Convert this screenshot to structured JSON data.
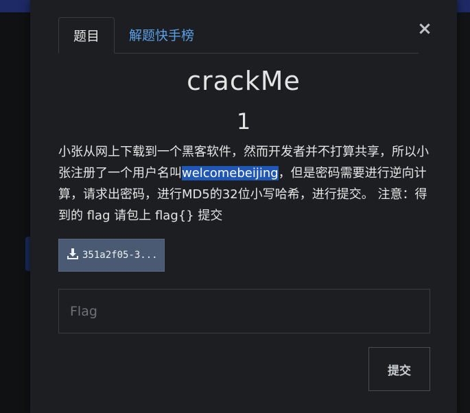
{
  "tabs": [
    {
      "label": "题目"
    },
    {
      "label": "解题快手榜"
    }
  ],
  "close_label": "×",
  "challenge": {
    "name": "crackMe",
    "points": "1",
    "description_before": "小张从网上下载到一个黑客软件，然而开发者并不打算共享，所以小张注册了一个用户名叫",
    "description_highlight": "welcomebeijing",
    "description_after": "，但是密码需要进行逆向计算，请求出密码，进行MD5的32位小写哈希，进行提交。 注意：得到的 flag 请包上 flag{} 提交"
  },
  "attachment": {
    "label": "351a2f05-3...",
    "icon": "download-icon"
  },
  "flag_input": {
    "placeholder": "Flag",
    "value": ""
  },
  "submit_label": "提交",
  "colors": {
    "modal_bg": "#1c1e21",
    "link": "#5aa0e6",
    "highlight": "#1e57b5",
    "attachment_bg": "#4a5a73"
  }
}
